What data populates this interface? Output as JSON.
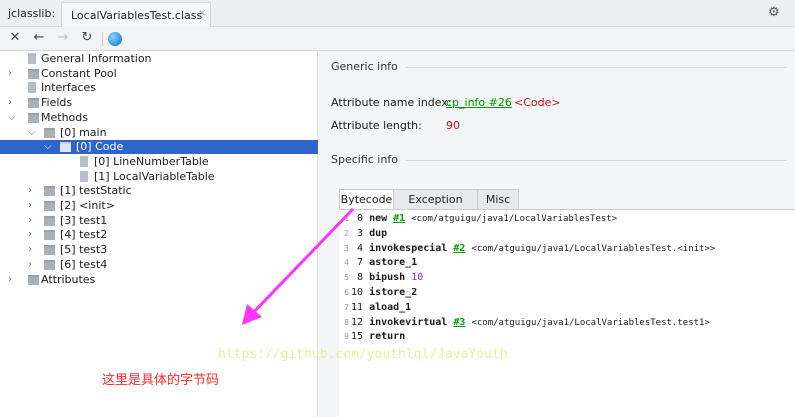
{
  "titlebar": {
    "app_name": "jclasslib:",
    "tab_label": "LocalVariablesTest.class",
    "close_glyph": "×",
    "settings_icon": "gear-icon"
  },
  "toolbar": {
    "icons": [
      "close-icon",
      "back-icon",
      "forward-icon",
      "refresh-icon",
      "web-icon"
    ]
  },
  "tree": {
    "rows": [
      {
        "label": "General Information",
        "icon": "file"
      },
      {
        "label": "Constant Pool",
        "icon": "folder",
        "arrow": "›"
      },
      {
        "label": "Interfaces",
        "icon": "file"
      },
      {
        "label": "Fields",
        "icon": "folder",
        "arrow": "›"
      },
      {
        "label": "Methods",
        "icon": "folder",
        "arrow": "⌄"
      },
      {
        "label": "[0] main",
        "icon": "folder",
        "arrow": "⌄"
      },
      {
        "label": "[0] Code",
        "icon": "folder",
        "arrow": "⌄",
        "selected": true
      },
      {
        "label": "[0] LineNumberTable",
        "icon": "file"
      },
      {
        "label": "[1] LocalVariableTable",
        "icon": "file"
      },
      {
        "label": "[1] testStatic",
        "icon": "folder",
        "arrow": "›"
      },
      {
        "label": "[2] <init>",
        "icon": "folder",
        "arrow": "›"
      },
      {
        "label": "[3] test1",
        "icon": "folder",
        "arrow": "›"
      },
      {
        "label": "[4] test2",
        "icon": "folder",
        "arrow": "›"
      },
      {
        "label": "[5] test3",
        "icon": "folder",
        "arrow": "›"
      },
      {
        "label": "[6] test4",
        "icon": "folder",
        "arrow": "›"
      },
      {
        "label": "Attributes",
        "icon": "folder",
        "arrow": "›"
      }
    ]
  },
  "annotation": {
    "text": "这里是具体的字节码",
    "color": "#ff2a2a",
    "arrow_color": "#ff33ff"
  },
  "detail": {
    "generic_info": "Generic info",
    "attr_name_label": "Attribute name index:",
    "attr_name_link": "cp_info #26",
    "attr_name_value": "<Code>",
    "attr_length_label": "Attribute length:",
    "attr_length_value": "90",
    "specific_info": "Specific info",
    "tabs": [
      "Bytecode",
      "Exception table",
      "Misc"
    ],
    "active_tab": "Bytecode"
  },
  "bytecode": [
    {
      "line": "1",
      "offset": "0",
      "op": "new",
      "ref": "#1",
      "comment": "<com/atguigu/java1/LocalVariablesTest>"
    },
    {
      "line": "2",
      "offset": "3",
      "op": "dup"
    },
    {
      "line": "3",
      "offset": "4",
      "op": "invokespecial",
      "ref": "#2",
      "comment": "<com/atguigu/java1/LocalVariablesTest.<init>>"
    },
    {
      "line": "4",
      "offset": "7",
      "op": "astore_1"
    },
    {
      "line": "5",
      "offset": "8",
      "op": "bipush",
      "imm": "10"
    },
    {
      "line": "6",
      "offset": "10",
      "op": "istore_2"
    },
    {
      "line": "7",
      "offset": "11",
      "op": "aload_1"
    },
    {
      "line": "8",
      "offset": "12",
      "op": "invokevirtual",
      "ref": "#3",
      "comment": "<com/atguigu/java1/LocalVariablesTest.test1>"
    },
    {
      "line": "9",
      "offset": "15",
      "op": "return"
    }
  ],
  "watermark": "https://github.com/youthlql/JavaYouth"
}
